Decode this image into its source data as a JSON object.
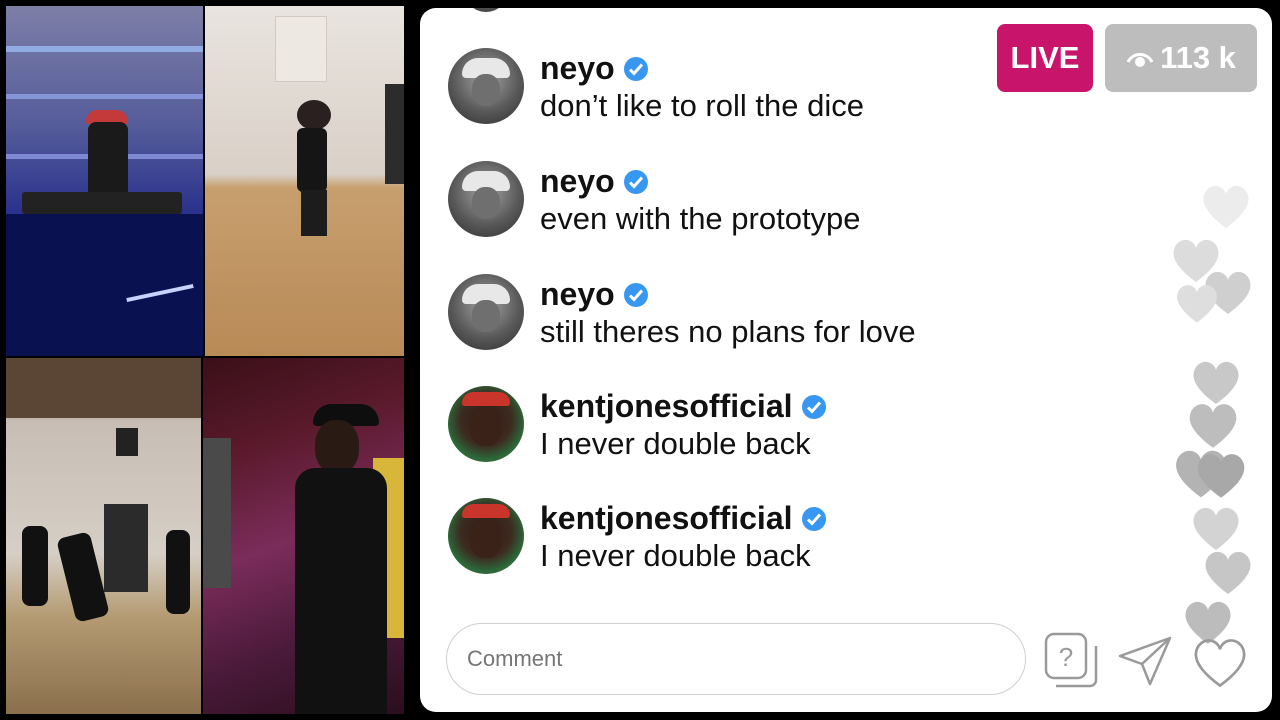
{
  "header": {
    "live_label": "LIVE",
    "viewers": "113 k"
  },
  "comments": [
    {
      "user": "neyo",
      "text": "don’t like to roll the dice",
      "verified": true
    },
    {
      "user": "neyo",
      "text": "even with the prototype",
      "verified": true
    },
    {
      "user": "neyo",
      "text": "still theres no plans for love",
      "verified": true
    },
    {
      "user": "kentjonesofficial",
      "text": "I never double back",
      "verified": true
    },
    {
      "user": "kentjonesofficial",
      "text": "I never double back",
      "verified": true
    }
  ],
  "composer": {
    "placeholder": "Comment"
  },
  "icons": [
    "eye-icon",
    "verified-icon",
    "question-box-icon",
    "send-icon",
    "heart-icon"
  ],
  "colors": {
    "live": "#c8156b",
    "verified": "#3897f0",
    "viewers_bg": "#bdbdbd"
  }
}
